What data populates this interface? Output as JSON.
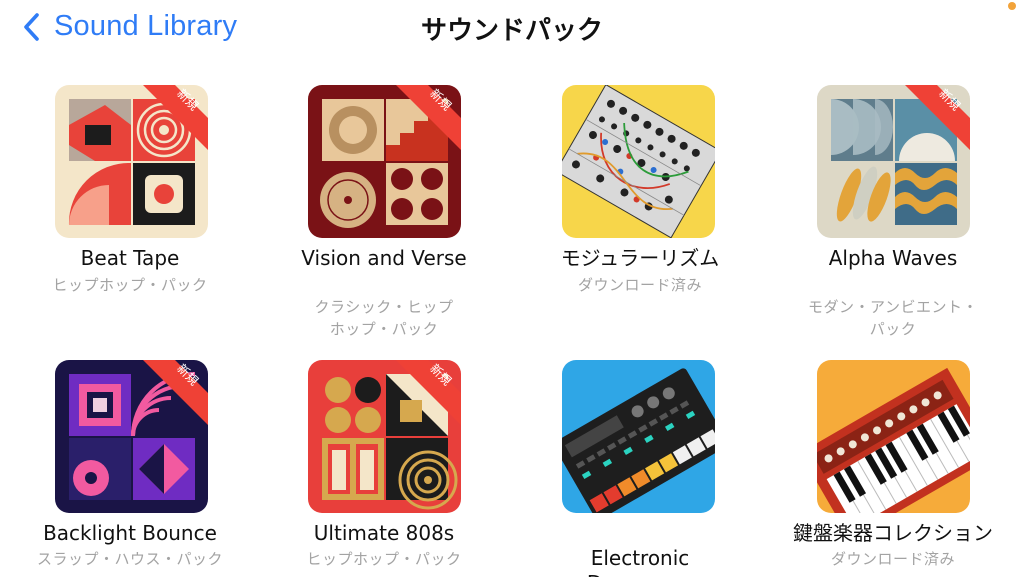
{
  "nav": {
    "back_label": "Sound Library",
    "title": "サウンドパック"
  },
  "badge_label": "新規",
  "packs": [
    {
      "name": "Beat Tape",
      "subtitle": "ヒップホップ・パック",
      "is_new": true,
      "icon": "beat-tape-artwork"
    },
    {
      "name": "Vision and Verse",
      "subtitle": "クラシック・ヒップ\nホップ・パック",
      "is_new": true,
      "icon": "vision-and-verse-artwork"
    },
    {
      "name": "モジュラーリズム",
      "subtitle": "ダウンロード済み",
      "is_new": false,
      "icon": "modular-rhythm-artwork"
    },
    {
      "name": "Alpha Waves",
      "subtitle": "モダン・アンビエント・\nパック",
      "is_new": true,
      "icon": "alpha-waves-artwork"
    },
    {
      "name": "Backlight Bounce",
      "subtitle": "スラップ・ハウス・パック",
      "is_new": true,
      "icon": "backlight-bounce-artwork"
    },
    {
      "name": "Ultimate 808s",
      "subtitle": "ヒップホップ・パック",
      "is_new": true,
      "icon": "ultimate-808s-artwork"
    },
    {
      "name": "Electronic\nDrummers",
      "subtitle": "",
      "is_new": false,
      "icon": "electronic-drummers-artwork"
    },
    {
      "name": "鍵盤楽器コレクション",
      "subtitle": "ダウンロード済み",
      "is_new": false,
      "icon": "keyboard-collection-artwork"
    }
  ],
  "colors": {
    "accent": "#2f7cf6",
    "badge": "#ef4136",
    "subtitle": "#a3a3a3"
  }
}
